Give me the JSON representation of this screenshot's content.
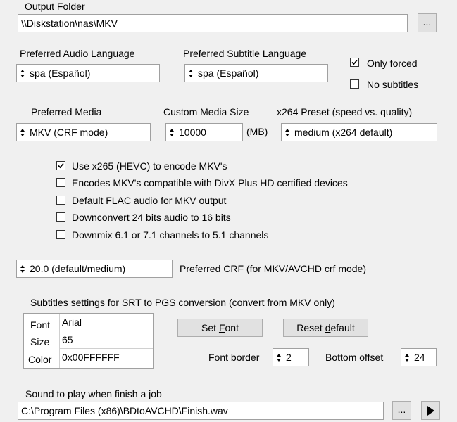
{
  "output_folder": {
    "label": "Output Folder",
    "path": "\\\\Diskstation\\nas\\MKV",
    "browse_label": "..."
  },
  "audio": {
    "label": "Preferred Audio Language",
    "value": "spa (Español)"
  },
  "subtitle": {
    "label": "Preferred Subtitle Language",
    "value": "spa (Español)"
  },
  "only_forced": {
    "label": "Only forced",
    "checked": true
  },
  "no_subtitles": {
    "label": "No subtitles",
    "checked": false
  },
  "media": {
    "label": "Preferred Media",
    "value": "MKV (CRF mode)"
  },
  "custom_media": {
    "label": "Custom Media Size",
    "value": "10000",
    "unit": "(MB)"
  },
  "x264_preset": {
    "label": "x264 Preset (speed vs. quality)",
    "value": "medium (x264 default)"
  },
  "options": [
    {
      "label": "Use x265 (HEVC) to encode MKV's",
      "checked": true
    },
    {
      "label": "Encodes MKV's compatible with DivX Plus HD certified devices",
      "checked": false
    },
    {
      "label": "Default FLAC audio for MKV output",
      "checked": false
    },
    {
      "label": "Downconvert 24 bits audio to 16 bits",
      "checked": false
    },
    {
      "label": "Downmix 6.1 or 7.1 channels to 5.1 channels",
      "checked": false
    }
  ],
  "crf": {
    "value": "20.0 (default/medium)",
    "label": "Preferred CRF (for MKV/AVCHD crf mode)"
  },
  "subtitles_settings": {
    "title": "Subtitles settings for SRT to PGS conversion (convert from MKV only)",
    "rows": [
      {
        "label": "Font",
        "value": "Arial"
      },
      {
        "label": "Size",
        "value": "65"
      },
      {
        "label": "Color",
        "value": "0x00FFFFFF"
      }
    ],
    "set_font_pre": "Set ",
    "set_font_ul": "F",
    "set_font_post": "ont",
    "reset_pre": "Reset ",
    "reset_ul": "d",
    "reset_post": "efault",
    "font_border_label": "Font border",
    "font_border_value": "2",
    "bottom_offset_label": "Bottom offset",
    "bottom_offset_value": "24"
  },
  "sound": {
    "label": "Sound to play when finish a job",
    "path": "C:\\Program Files (x86)\\BDtoAVCHD\\Finish.wav",
    "browse_label": "..."
  }
}
